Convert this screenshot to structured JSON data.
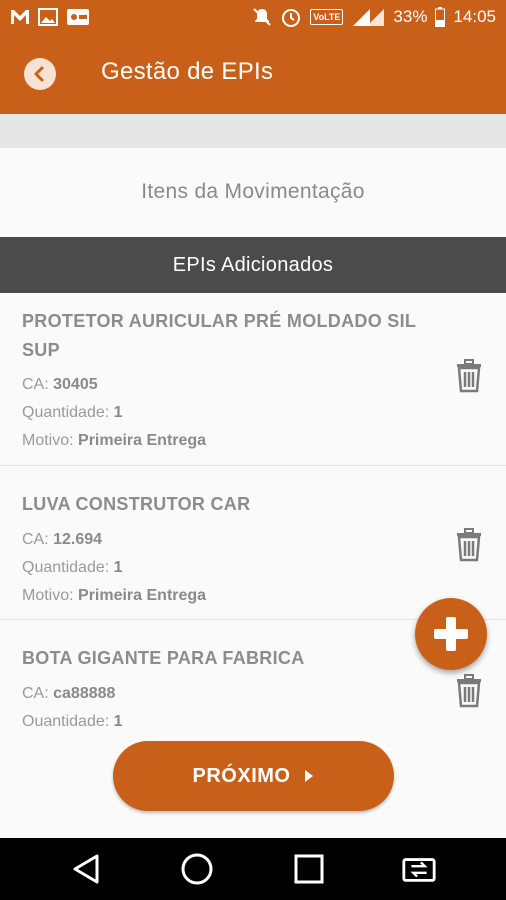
{
  "status_bar": {
    "battery": "33%",
    "time": "14:05",
    "volte": "VoLTE",
    "icons": [
      "gmail-icon",
      "image-icon",
      "vpn-icon",
      "mute-icon",
      "alarm-icon",
      "signal-icon",
      "battery-icon"
    ]
  },
  "app_bar": {
    "title": "Gestão de EPIs",
    "back_icon": "back-arrow-icon"
  },
  "section": {
    "title": "Itens da Movimentação"
  },
  "list_header": {
    "title": "EPIs Adicionados"
  },
  "labels": {
    "ca": "CA: ",
    "quantidade": "Quantidade: ",
    "motivo": "Motivo: "
  },
  "items": [
    {
      "name": "PROTETOR AURICULAR PRÉ MOLDADO SIL SUP",
      "ca": "30405",
      "quantidade": "1",
      "motivo": "Primeira Entrega"
    },
    {
      "name": "LUVA CONSTRUTOR CAR",
      "ca": "12.694",
      "quantidade": "1",
      "motivo": "Primeira Entrega"
    },
    {
      "name": "BOTA GIGANTE PARA FABRICA",
      "ca": "ca88888",
      "quantidade": "1",
      "motivo": ""
    }
  ],
  "fab": {
    "icon": "plus-icon"
  },
  "next_button": {
    "label": "PRÓXIMO",
    "icon": "play-arrow-icon"
  },
  "colors": {
    "primary": "#c8601a",
    "header_dark": "#4b4b4b",
    "text_grey": "#8c8c8c"
  }
}
